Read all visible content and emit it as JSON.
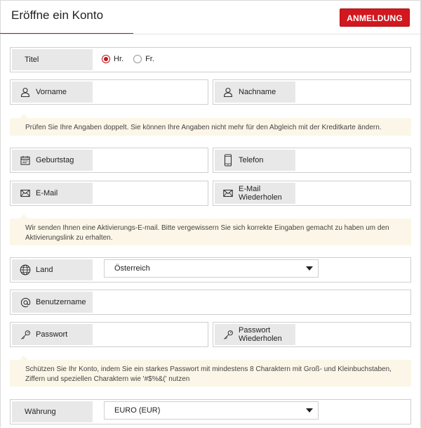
{
  "header": {
    "title": "Eröffne ein Konto",
    "login_label": "ANMELDUNG"
  },
  "form": {
    "title_field": {
      "label": "Titel",
      "options": [
        {
          "label": "Hr.",
          "selected": true
        },
        {
          "label": "Fr.",
          "selected": false
        }
      ]
    },
    "first_name": {
      "label": "Vorname",
      "icon": "user-icon"
    },
    "last_name": {
      "label": "Nachname",
      "icon": "user-icon"
    },
    "notice_names": "Prüfen Sie Ihre Angaben doppelt. Sie können Ihre Angaben nicht mehr für den Abgleich mit der Kreditkarte ändern.",
    "birthday": {
      "label": "Geburtstag",
      "icon": "calendar-icon"
    },
    "phone": {
      "label": "Telefon",
      "icon": "phone-icon"
    },
    "email": {
      "label": "E-Mail",
      "icon": "envelope-icon"
    },
    "email_repeat": {
      "label_line1": "E-Mail",
      "label_line2": "Wiederholen",
      "icon": "envelope-icon"
    },
    "notice_email": "Wir senden Ihnen eine Aktivierungs-E-mail. Bitte vergewissern Sie sich korrekte Eingaben gemacht zu haben um den Aktivierungslink zu erhalten.",
    "country": {
      "label": "Land",
      "icon": "globe-icon",
      "value": "Österreich"
    },
    "username": {
      "label": "Benutzername",
      "icon": "at-icon"
    },
    "password": {
      "label": "Passwort",
      "icon": "key-icon"
    },
    "password_repeat": {
      "label_line1": "Passwort",
      "label_line2": "Wiederholen",
      "icon": "key-icon"
    },
    "notice_password": "Schützen Sie Ihr Konto, indem Sie ein starkes Passwort mit mindestens 8 Charaktern mit Groß- und Kleinbuchstaben, Ziffern und speziellen Charaktern wie '#$%&(' nutzen",
    "currency": {
      "label": "Währung",
      "value": "EURO (EUR)"
    }
  },
  "colors": {
    "accent": "#d2171e",
    "label_bg": "#e8e8e8",
    "notice_bg": "#fbf6e7"
  }
}
